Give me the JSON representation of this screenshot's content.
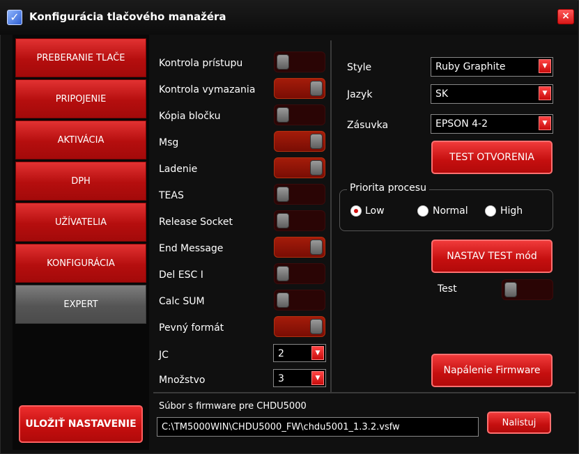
{
  "window": {
    "title": "Konfigurácia tlačového manažéra",
    "close_glyph": "×",
    "app_icon": "checkmark-app-icon"
  },
  "sidebar": {
    "items": [
      {
        "label": "PREBERANIE TLAČE"
      },
      {
        "label": "PRIPOJENIE"
      },
      {
        "label": "AKTIVÁCIA"
      },
      {
        "label": "DPH"
      },
      {
        "label": "UŽÍVATELIA"
      },
      {
        "label": "KONFIGURÁCIA"
      },
      {
        "label": "EXPERT"
      }
    ],
    "active_item": "EXPERT",
    "save_label": "ULOŽIŤ NASTAVENIE"
  },
  "toggles": [
    {
      "label": "Kontrola prístupu",
      "on": false
    },
    {
      "label": "Kontrola vymazania",
      "on": true
    },
    {
      "label": "Kópia bločku",
      "on": false
    },
    {
      "label": "Msg",
      "on": true
    },
    {
      "label": "Ladenie",
      "on": true
    },
    {
      "label": "TEAS",
      "on": false
    },
    {
      "label": "Release Socket",
      "on": false
    },
    {
      "label": "End Message",
      "on": true
    },
    {
      "label": "Del ESC I",
      "on": false
    },
    {
      "label": "Calc SUM",
      "on": false
    },
    {
      "label": "Pevný formát",
      "on": true
    }
  ],
  "jc": {
    "label": "JC",
    "value": "2"
  },
  "mnozstvo": {
    "label": "Množstvo",
    "value": "3"
  },
  "settings": {
    "style": {
      "label": "Style",
      "value": "Ruby Graphite"
    },
    "jazyk": {
      "label": "Jazyk",
      "value": "SK"
    },
    "zasuvka": {
      "label": "Zásuvka",
      "value": "EPSON 4-2"
    },
    "test_otvorenia_label": "TEST OTVORENIA"
  },
  "priority": {
    "legend": "Priorita procesu",
    "options": [
      {
        "label": "Low",
        "checked": true
      },
      {
        "label": "Normal",
        "checked": false
      },
      {
        "label": "High",
        "checked": false
      }
    ]
  },
  "test_mode": {
    "button_label": "NASTAV TEST mód",
    "test_label": "Test",
    "test_on": false
  },
  "firmware": {
    "button_label": "Napálenie Firmware",
    "file_label": "Súbor s firmware pre CHDU5000",
    "path": "C:\\TM5000WIN\\CHDU5000_FW\\chdu5001_1.3.2.vsfw",
    "browse_label": "Nalistuj"
  },
  "colors": {
    "accent": "#c50f0f",
    "background": "#101010",
    "toggle_on": "#a41c0a",
    "active_nav": "#5e5e5e"
  }
}
